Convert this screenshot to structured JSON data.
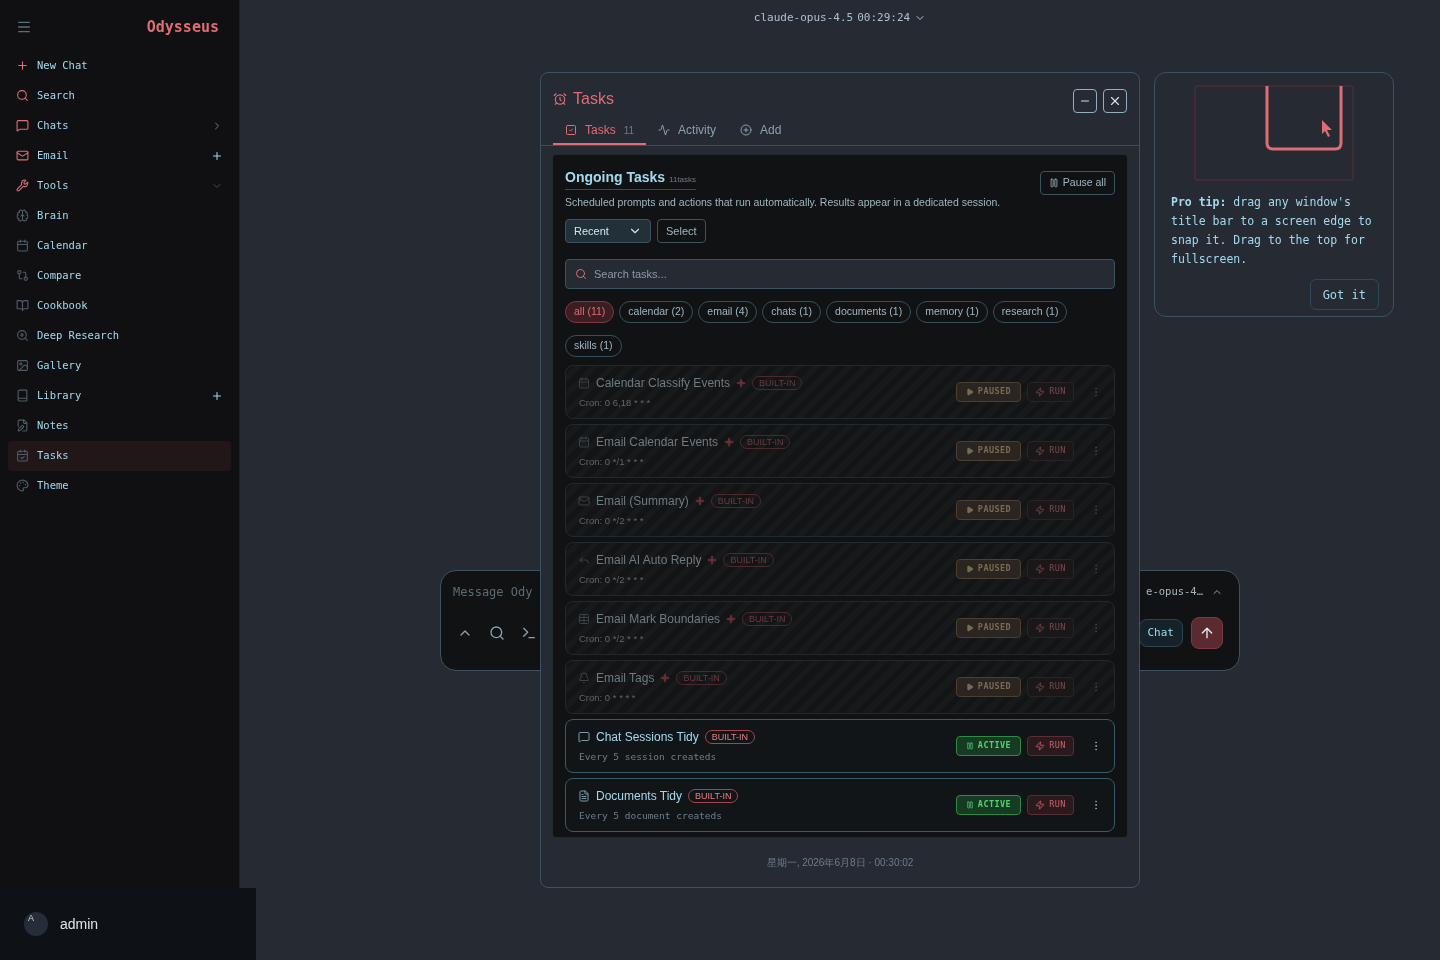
{
  "sidebar": {
    "brand": "Odysseus",
    "items": [
      {
        "label": "New Chat",
        "selected": false
      },
      {
        "label": "Search",
        "selected": false
      },
      {
        "label": "Chats",
        "selected": false
      },
      {
        "label": "Email",
        "selected": false
      },
      {
        "label": "Tools",
        "selected": false
      },
      {
        "label": "Brain",
        "selected": false
      },
      {
        "label": "Calendar",
        "selected": false
      },
      {
        "label": "Compare",
        "selected": false
      },
      {
        "label": "Cookbook",
        "selected": false
      },
      {
        "label": "Deep Research",
        "selected": false
      },
      {
        "label": "Gallery",
        "selected": false
      },
      {
        "label": "Library",
        "selected": false
      },
      {
        "label": "Notes",
        "selected": false
      },
      {
        "label": "Tasks",
        "selected": true
      },
      {
        "label": "Theme",
        "selected": false
      }
    ],
    "user": {
      "initial": "A",
      "name": "admin"
    }
  },
  "top_bar": {
    "model": "claude-opus-4.5",
    "time": "00:29:24"
  },
  "composer": {
    "placeholder": "Message Ody",
    "model": "e-opus-4…",
    "mode": "Chat"
  },
  "tasks_window": {
    "title": "Tasks",
    "tabs": [
      {
        "label": "Tasks",
        "count": "11",
        "selected": true
      },
      {
        "label": "Activity",
        "selected": false
      },
      {
        "label": "Add",
        "selected": false
      }
    ],
    "heading": "Ongoing Tasks",
    "heading_count": "11tasks",
    "pause_all": "Pause all",
    "description": "Scheduled prompts and actions that run automatically. Results appear in a dedicated session.",
    "sort": "Recent",
    "select": "Select",
    "search_placeholder": "Search tasks...",
    "filters": [
      {
        "label": "all (11)",
        "selected": true
      },
      {
        "label": "calendar (2)",
        "selected": false
      },
      {
        "label": "email (4)",
        "selected": false
      },
      {
        "label": "chats (1)",
        "selected": false
      },
      {
        "label": "documents (1)",
        "selected": false
      },
      {
        "label": "memory (1)",
        "selected": false
      },
      {
        "label": "research (1)",
        "selected": false
      },
      {
        "label": "skills (1)",
        "selected": false
      }
    ],
    "tasks": [
      {
        "name": "Calendar Classify Events",
        "badge": "BUILT-IN",
        "schedule": "Cron: 0 6,18 * * *",
        "status": "PAUSED",
        "active": false,
        "run": "RUN"
      },
      {
        "name": "Email Calendar Events",
        "badge": "BUILT-IN",
        "schedule": "Cron: 0 */1 * * *",
        "status": "PAUSED",
        "active": false,
        "run": "RUN"
      },
      {
        "name": "Email (Summary)",
        "badge": "BUILT-IN",
        "schedule": "Cron: 0 */2 * * *",
        "status": "PAUSED",
        "active": false,
        "run": "RUN"
      },
      {
        "name": "Email AI Auto Reply",
        "badge": "BUILT-IN",
        "schedule": "Cron: 0 */2 * * *",
        "status": "PAUSED",
        "active": false,
        "run": "RUN"
      },
      {
        "name": "Email Mark Boundaries",
        "badge": "BUILT-IN",
        "schedule": "Cron: 0 */2 * * *",
        "status": "PAUSED",
        "active": false,
        "run": "RUN"
      },
      {
        "name": "Email Tags",
        "badge": "BUILT-IN",
        "schedule": "Cron: 0 * * * *",
        "status": "PAUSED",
        "active": false,
        "run": "RUN"
      },
      {
        "name": "Chat Sessions Tidy",
        "badge": "BUILT-IN",
        "schedule": "Every 5 session createds",
        "status": "ACTIVE",
        "active": true,
        "run": "RUN"
      },
      {
        "name": "Documents Tidy",
        "badge": "BUILT-IN",
        "schedule": "Every 5 document createds",
        "status": "ACTIVE",
        "active": true,
        "run": "RUN"
      }
    ],
    "footer": "星期一, 2026年6月8日 · 00:30:02"
  },
  "tip": {
    "text": "**Pro tip:** drag any window's title bar to a screen edge to snap it. Drag to the top for fullscreen.",
    "button": "Got it"
  }
}
